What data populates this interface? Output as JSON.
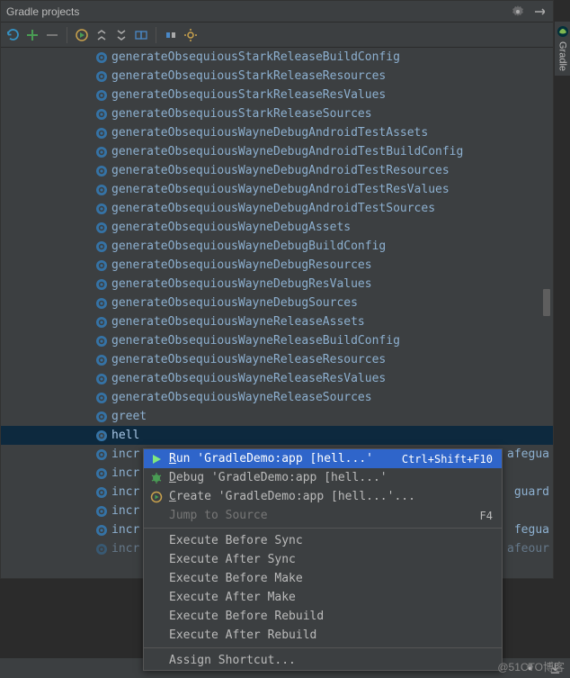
{
  "panel": {
    "title": "Gradle projects"
  },
  "tasks": [
    {
      "label": "generateObsequiousStarkReleaseBuildConfig"
    },
    {
      "label": "generateObsequiousStarkReleaseResources"
    },
    {
      "label": "generateObsequiousStarkReleaseResValues"
    },
    {
      "label": "generateObsequiousStarkReleaseSources"
    },
    {
      "label": "generateObsequiousWayneDebugAndroidTestAssets"
    },
    {
      "label": "generateObsequiousWayneDebugAndroidTestBuildConfig"
    },
    {
      "label": "generateObsequiousWayneDebugAndroidTestResources"
    },
    {
      "label": "generateObsequiousWayneDebugAndroidTestResValues"
    },
    {
      "label": "generateObsequiousWayneDebugAndroidTestSources"
    },
    {
      "label": "generateObsequiousWayneDebugAssets"
    },
    {
      "label": "generateObsequiousWayneDebugBuildConfig"
    },
    {
      "label": "generateObsequiousWayneDebugResources"
    },
    {
      "label": "generateObsequiousWayneDebugResValues"
    },
    {
      "label": "generateObsequiousWayneDebugSources"
    },
    {
      "label": "generateObsequiousWayneReleaseAssets"
    },
    {
      "label": "generateObsequiousWayneReleaseBuildConfig"
    },
    {
      "label": "generateObsequiousWayneReleaseResources"
    },
    {
      "label": "generateObsequiousWayneReleaseResValues"
    },
    {
      "label": "generateObsequiousWayneReleaseSources"
    },
    {
      "label": "greet"
    },
    {
      "label": "hell",
      "selected": true
    },
    {
      "label": "incr",
      "trail": "afegua"
    },
    {
      "label": "incr"
    },
    {
      "label": "incr",
      "trail": "guard"
    },
    {
      "label": "incr"
    },
    {
      "label": "incr",
      "trail": "fegua"
    },
    {
      "label": "incr",
      "dimmed": true,
      "trail": "afeour"
    }
  ],
  "context_menu": {
    "items": [
      {
        "icon": "run",
        "label": "Run 'GradleDemo:app [hell...'",
        "shortcut": "Ctrl+Shift+F10",
        "highlighted": true,
        "u": true
      },
      {
        "icon": "debug",
        "label": "Debug 'GradleDemo:app [hell...'",
        "u": true
      },
      {
        "icon": "create",
        "label": "Create 'GradleDemo:app [hell...'...",
        "u": true
      },
      {
        "label": "Jump to Source",
        "shortcut": "F4",
        "disabled": true
      },
      {
        "sep": true
      },
      {
        "label": "Execute Before Sync"
      },
      {
        "label": "Execute After Sync"
      },
      {
        "label": "Execute Before Make"
      },
      {
        "label": "Execute After Make"
      },
      {
        "label": "Execute Before Rebuild"
      },
      {
        "label": "Execute After Rebuild"
      },
      {
        "sep": true
      },
      {
        "label": "Assign Shortcut..."
      }
    ]
  },
  "side_tab": {
    "label": "Gradle"
  },
  "watermark": "@51CTO博客"
}
